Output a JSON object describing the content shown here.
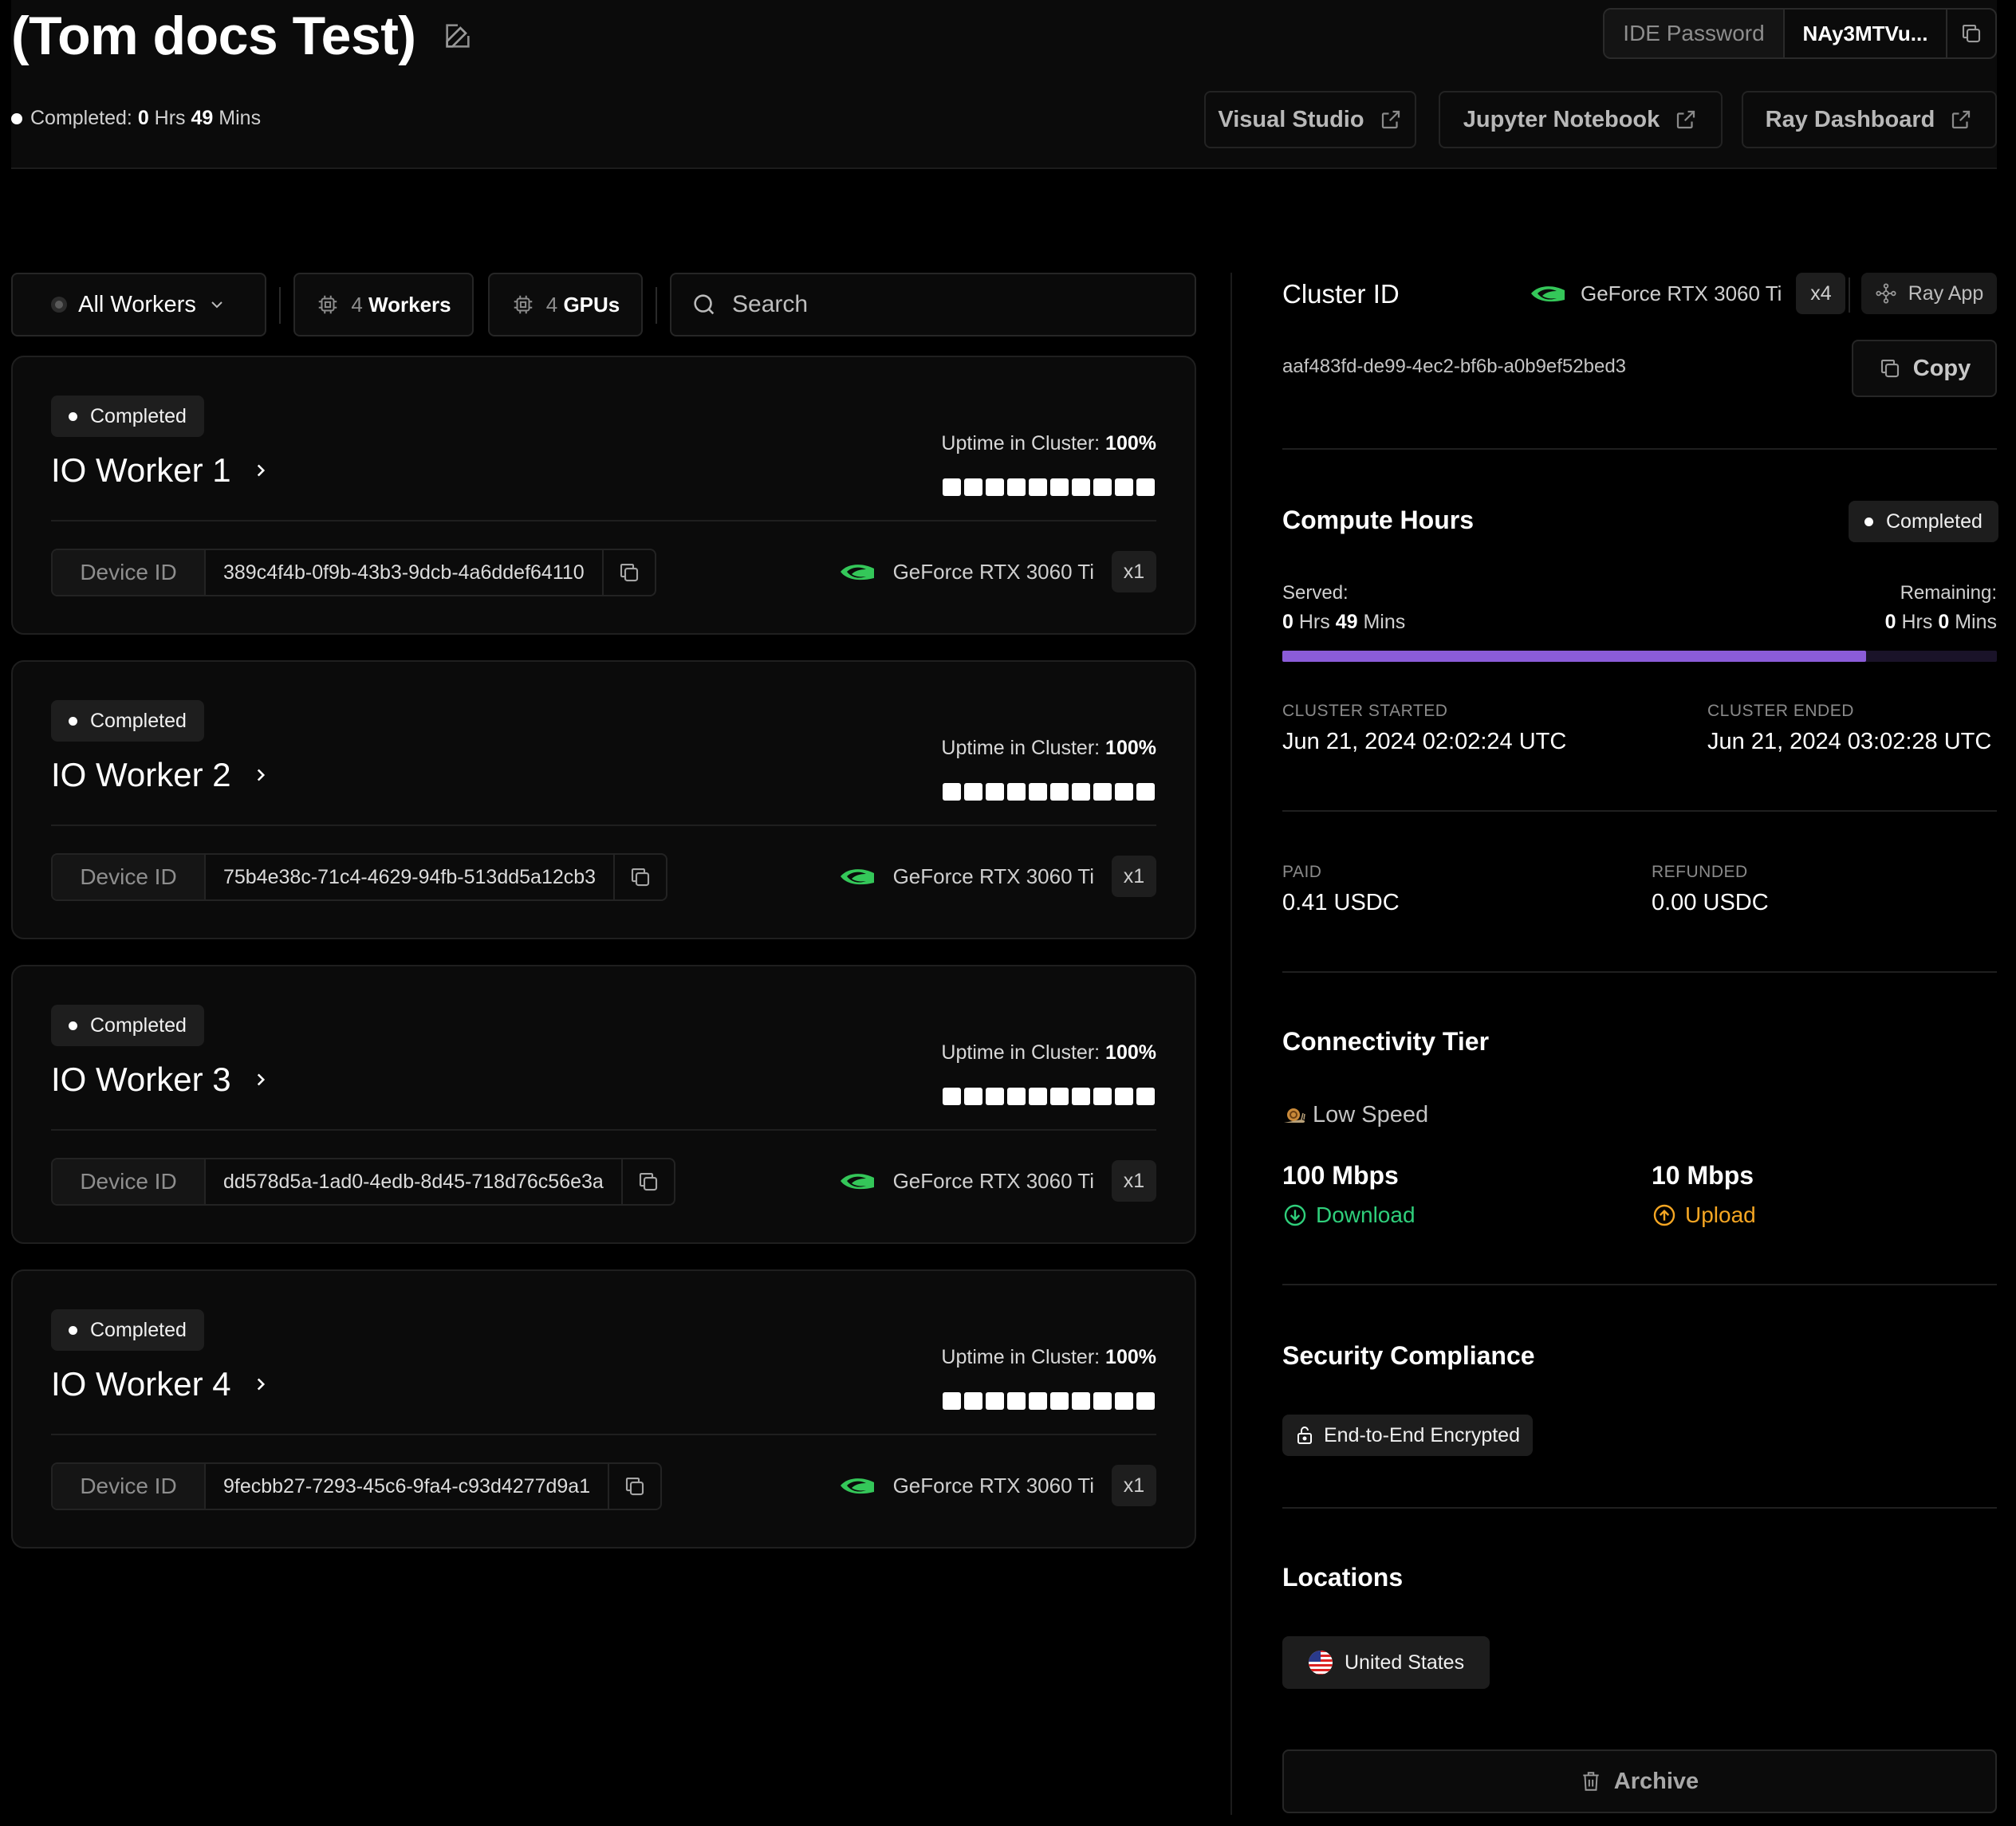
{
  "header": {
    "title": "(Tom docs Test)",
    "status": {
      "label": "Completed:",
      "hrs_value": "0",
      "hrs_unit": "Hrs",
      "mins_value": "49",
      "mins_unit": "Mins"
    },
    "ide_password": {
      "label": "IDE Password",
      "value": "NAy3MTVu..."
    },
    "external_links": [
      {
        "label": "Visual Studio"
      },
      {
        "label": "Jupyter Notebook"
      },
      {
        "label": "Ray Dashboard"
      }
    ]
  },
  "toolbar": {
    "filter": "All Workers",
    "workers": {
      "count": "4",
      "label": "Workers"
    },
    "gpus": {
      "count": "4",
      "label": "GPUs"
    },
    "search_placeholder": "Search"
  },
  "workers": [
    {
      "status": "Completed",
      "name": "IO Worker 1",
      "uptime_label": "Uptime in Cluster:",
      "uptime_value": "100%",
      "device_label": "Device ID",
      "device_id": "389c4f4b-0f9b-43b3-9dcb-4a6ddef64110",
      "gpu": "GeForce RTX 3060 Ti",
      "gpu_count": "x1"
    },
    {
      "status": "Completed",
      "name": "IO Worker 2",
      "uptime_label": "Uptime in Cluster:",
      "uptime_value": "100%",
      "device_label": "Device ID",
      "device_id": "75b4e38c-71c4-4629-94fb-513dd5a12cb3",
      "gpu": "GeForce RTX 3060 Ti",
      "gpu_count": "x1"
    },
    {
      "status": "Completed",
      "name": "IO Worker 3",
      "uptime_label": "Uptime in Cluster:",
      "uptime_value": "100%",
      "device_label": "Device ID",
      "device_id": "dd578d5a-1ad0-4edb-8d45-718d76c56e3a",
      "gpu": "GeForce RTX 3060 Ti",
      "gpu_count": "x1"
    },
    {
      "status": "Completed",
      "name": "IO Worker 4",
      "uptime_label": "Uptime in Cluster:",
      "uptime_value": "100%",
      "device_label": "Device ID",
      "device_id": "9fecbb27-7293-45c6-9fa4-c93d4277d9a1",
      "gpu": "GeForce RTX 3060 Ti",
      "gpu_count": "x1"
    }
  ],
  "cluster": {
    "title": "Cluster ID",
    "gpu": "GeForce RTX 3060 Ti",
    "gpu_count": "x4",
    "ray_app": "Ray App",
    "id": "aaf483fd-de99-4ec2-bf6b-a0b9ef52bed3",
    "copy": "Copy"
  },
  "compute": {
    "title": "Compute Hours",
    "status": "Completed",
    "served_label": "Served:",
    "served": {
      "hrs": "0",
      "hrs_unit": "Hrs",
      "mins": "49",
      "mins_unit": "Mins"
    },
    "remaining_label": "Remaining:",
    "remaining": {
      "hrs": "0",
      "hrs_unit": "Hrs",
      "mins": "0",
      "mins_unit": "Mins"
    },
    "progress_fraction": 0.817,
    "started_label": "CLUSTER STARTED",
    "started": "Jun 21, 2024 02:02:24 UTC",
    "ended_label": "CLUSTER ENDED",
    "ended": "Jun 21, 2024 03:02:28 UTC",
    "paid_label": "PAID",
    "paid": "0.41 USDC",
    "refunded_label": "REFUNDED",
    "refunded": "0.00 USDC"
  },
  "connectivity": {
    "title": "Connectivity Tier",
    "tier": "Low Speed",
    "download_value": "100 Mbps",
    "download_label": "Download",
    "upload_value": "10 Mbps",
    "upload_label": "Upload"
  },
  "security": {
    "title": "Security Compliance",
    "badge": "End-to-End Encrypted"
  },
  "locations": {
    "title": "Locations",
    "items": [
      "United States"
    ]
  },
  "archive": "Archive",
  "colors": {
    "accent_purple": "#8b5cd9",
    "download_green": "#2fcf7b",
    "upload_orange": "#f5a623",
    "nvidia_green": "#34c759"
  },
  "icons": [
    "edit-icon",
    "copy-icon",
    "external-link-icon",
    "chevron-down-icon",
    "chip-icon",
    "search-icon",
    "chevron-right-icon",
    "nvidia-icon",
    "ray-icon",
    "snail-icon",
    "download-icon",
    "upload-icon",
    "lock-icon",
    "us-flag-icon",
    "trash-icon"
  ]
}
